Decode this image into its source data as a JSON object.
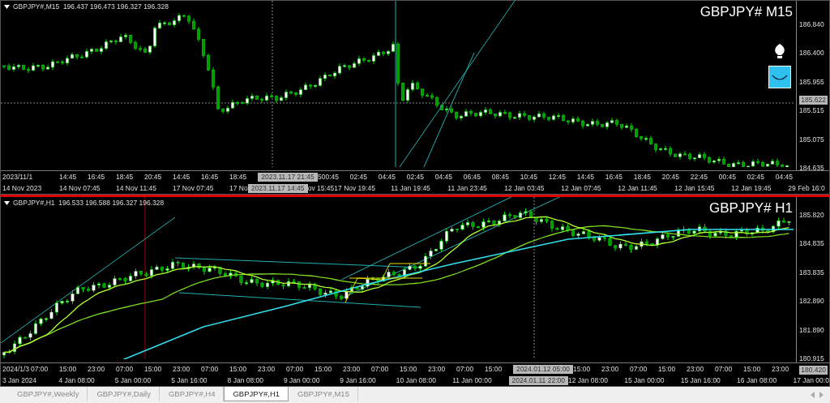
{
  "panes": [
    {
      "kind": "m15",
      "selected": false,
      "header": "GBPJPY#,M15  196.437 196.473 196.327 196.328",
      "title": "GBPJPY# M15",
      "price_axis": [
        "186.840",
        "186.400",
        "185.955",
        "185.515",
        "185.075",
        "184.635"
      ],
      "cursor_price": "185.622",
      "time_upper": [
        {
          "text": "2023/11/1",
          "kind": "date"
        },
        {
          "text": "14:45",
          "kind": "tick"
        },
        {
          "text": "16:45",
          "kind": "tick"
        },
        {
          "text": "18:45",
          "kind": "tick"
        },
        {
          "text": "20:45",
          "kind": "tick"
        },
        {
          "text": "14:45",
          "kind": "tick"
        },
        {
          "text": "16:45",
          "kind": "tick"
        },
        {
          "text": "18:45",
          "kind": "tick"
        },
        {
          "text": "2023.11.17 21:45",
          "kind": "cursor"
        },
        {
          "text": "5",
          "kind": "cut"
        },
        {
          "text": "00:45",
          "kind": "tick"
        },
        {
          "text": "02:45",
          "kind": "tick"
        },
        {
          "text": "04:45",
          "kind": "tick"
        },
        {
          "text": "02:45",
          "kind": "tick"
        },
        {
          "text": "04:45",
          "kind": "tick"
        },
        {
          "text": "06:45",
          "kind": "tick"
        },
        {
          "text": "08:45",
          "kind": "tick"
        },
        {
          "text": "10:45",
          "kind": "tick"
        },
        {
          "text": "12:45",
          "kind": "tick"
        },
        {
          "text": "14:45",
          "kind": "tick"
        },
        {
          "text": "16:45",
          "kind": "tick"
        },
        {
          "text": "18:45",
          "kind": "tick"
        },
        {
          "text": "20:45",
          "kind": "tick"
        },
        {
          "text": "22:45",
          "kind": "tick"
        },
        {
          "text": "00:45",
          "kind": "tick"
        },
        {
          "text": "02:45",
          "kind": "tick"
        },
        {
          "text": "04:45",
          "kind": "tick"
        }
      ],
      "time_lower": [
        {
          "text": "14 Nov 2023",
          "kind": "tick"
        },
        {
          "text": "14 Nov 07:45",
          "kind": "tick"
        },
        {
          "text": "14 Nov 11:45",
          "kind": "tick"
        },
        {
          "text": "17 Nov 07:45",
          "kind": "tick"
        },
        {
          "text": "17 No",
          "kind": "cut"
        },
        {
          "text": "2023.11.17 14:45",
          "kind": "cursor"
        },
        {
          "text": "ov 15:45",
          "kind": "cut"
        },
        {
          "text": "17 Nov 19:45",
          "kind": "tick"
        },
        {
          "text": "11 Jan 19:45",
          "kind": "tick"
        },
        {
          "text": "11 Jan 23:45",
          "kind": "tick"
        },
        {
          "text": "12 Jan 03:45",
          "kind": "tick"
        },
        {
          "text": "12 Jan 07:45",
          "kind": "tick"
        },
        {
          "text": "12 Jan 11:45",
          "kind": "tick"
        },
        {
          "text": "12 Jan 15:45",
          "kind": "tick"
        },
        {
          "text": "12 Jan 19:45",
          "kind": "tick"
        },
        {
          "text": "29 Feb 16:0",
          "kind": "edge"
        }
      ]
    },
    {
      "kind": "h1",
      "selected": true,
      "header": "GBPJPY#,H1  196.533 196.588 196.327 196.328",
      "title": "GBPJPY# H1",
      "price_axis": [
        "185.820",
        "184.835",
        "183.835",
        "182.890",
        "181.890",
        "180.915"
      ],
      "cursor_price": "180.420",
      "time_upper": [
        {
          "text": "2024/1/3",
          "kind": "start"
        },
        {
          "text": "07:00",
          "kind": "tick"
        },
        {
          "text": "15:00",
          "kind": "tick"
        },
        {
          "text": "23:00",
          "kind": "tick"
        },
        {
          "text": "07:00",
          "kind": "tick"
        },
        {
          "text": "15:00",
          "kind": "tick"
        },
        {
          "text": "23:00",
          "kind": "tick"
        },
        {
          "text": "07:00",
          "kind": "tick"
        },
        {
          "text": "15:00",
          "kind": "tick"
        },
        {
          "text": "23:00",
          "kind": "tick"
        },
        {
          "text": "07:00",
          "kind": "tick"
        },
        {
          "text": "15:00",
          "kind": "tick"
        },
        {
          "text": "23:00",
          "kind": "tick"
        },
        {
          "text": "07:00",
          "kind": "tick"
        },
        {
          "text": "15:00",
          "kind": "tick"
        },
        {
          "text": "23:00",
          "kind": "tick"
        },
        {
          "text": "07:00",
          "kind": "tick"
        },
        {
          "text": "15:00",
          "kind": "tick"
        },
        {
          "text": "2024.01.12 05:00",
          "kind": "cursor"
        },
        {
          "text": "15:00",
          "kind": "tick"
        },
        {
          "text": "23:00",
          "kind": "tick"
        },
        {
          "text": "07:00",
          "kind": "tick"
        },
        {
          "text": "15:00",
          "kind": "tick"
        },
        {
          "text": "23:00",
          "kind": "tick"
        },
        {
          "text": "07:00",
          "kind": "tick"
        },
        {
          "text": "15:00",
          "kind": "tick"
        },
        {
          "text": "23:00",
          "kind": "tick"
        }
      ],
      "time_lower": [
        {
          "text": "3 Jan 2024",
          "kind": "tick"
        },
        {
          "text": "4 Jan 08:00",
          "kind": "tick"
        },
        {
          "text": "5 Jan 00:00",
          "kind": "tick"
        },
        {
          "text": "5 Jan 16:00",
          "kind": "tick"
        },
        {
          "text": "8 Jan 08:00",
          "kind": "tick"
        },
        {
          "text": "9 Jan 00:00",
          "kind": "tick"
        },
        {
          "text": "9 Jan 16:00",
          "kind": "tick"
        },
        {
          "text": "10 Jan 08:00",
          "kind": "tick"
        },
        {
          "text": "11 Jan 00:00",
          "kind": "tick"
        },
        {
          "text": "2024.01.11 22:00",
          "kind": "cursor"
        },
        {
          "text": "12 Jan 08:00",
          "kind": "tick"
        },
        {
          "text": "15 Jan 00:00",
          "kind": "tick"
        },
        {
          "text": "15 Jan 16:00",
          "kind": "tick"
        },
        {
          "text": "16 Jan 08:00",
          "kind": "tick"
        },
        {
          "text": "17 Jan 00:0",
          "kind": "edge"
        }
      ]
    }
  ],
  "tabs": [
    {
      "label": "GBPJPY#,Weekly",
      "selected": false
    },
    {
      "label": "GBPJPY#,Daily",
      "selected": false
    },
    {
      "label": "GBPJPY#,H4",
      "selected": false
    },
    {
      "label": "GBPJPY#,H1",
      "selected": true
    },
    {
      "label": "GBPJPY#,M15",
      "selected": false
    }
  ]
}
